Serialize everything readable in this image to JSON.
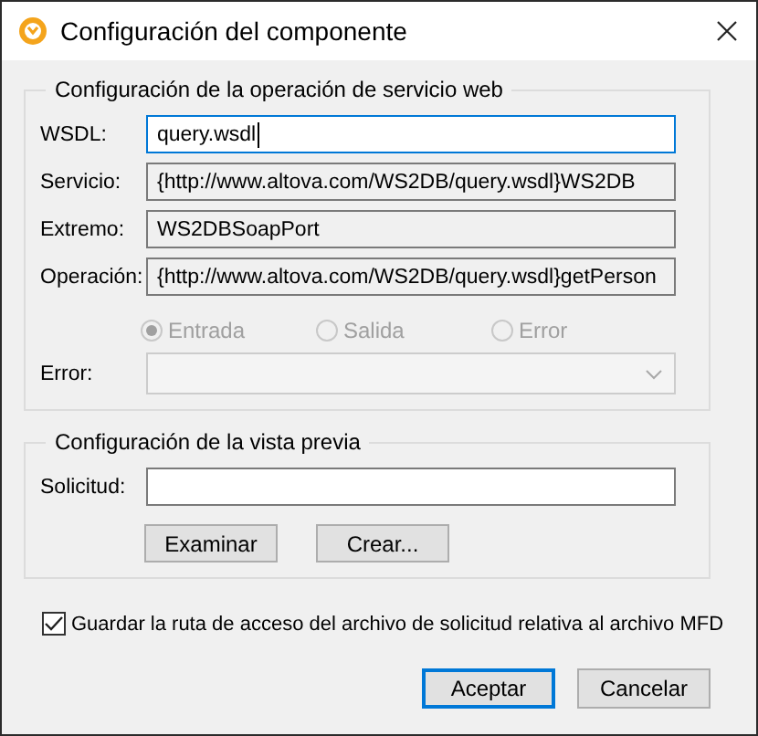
{
  "window": {
    "title": "Configuración del componente"
  },
  "web_service_group": {
    "title": "Configuración de la operación de servicio web",
    "fields": [
      {
        "label": "WSDL:",
        "value": "query.wsdl",
        "kind": "editable",
        "focused": true
      },
      {
        "label": "Servicio:",
        "value": "{http://www.altova.com/WS2DB/query.wsdl}WS2DB",
        "kind": "readonly",
        "focused": false
      },
      {
        "label": "Extremo:",
        "value": "WS2DBSoapPort",
        "kind": "readonly",
        "focused": false
      },
      {
        "label": "Operación:",
        "value": "{http://www.altova.com/WS2DB/query.wsdl}getPerson",
        "kind": "readonly",
        "focused": false
      }
    ],
    "message_radios": [
      {
        "label": "Entrada",
        "selected": true,
        "disabled": true
      },
      {
        "label": "Salida",
        "selected": false,
        "disabled": true
      },
      {
        "label": "Error",
        "selected": false,
        "disabled": true
      }
    ],
    "error_field": {
      "label": "Error:",
      "disabled": true
    }
  },
  "preview_group": {
    "title": "Configuración de la vista previa",
    "request_field": {
      "label": "Solicitud:"
    },
    "buttons": [
      "Examinar",
      "Crear..."
    ]
  },
  "save_relative": {
    "label": "Guardar la ruta de acceso del archivo de solicitud relativa al archivo MFD",
    "checked": true
  },
  "buttons": [
    {
      "label": "Aceptar",
      "default": true
    },
    {
      "label": "Cancelar",
      "default": false
    }
  ]
}
